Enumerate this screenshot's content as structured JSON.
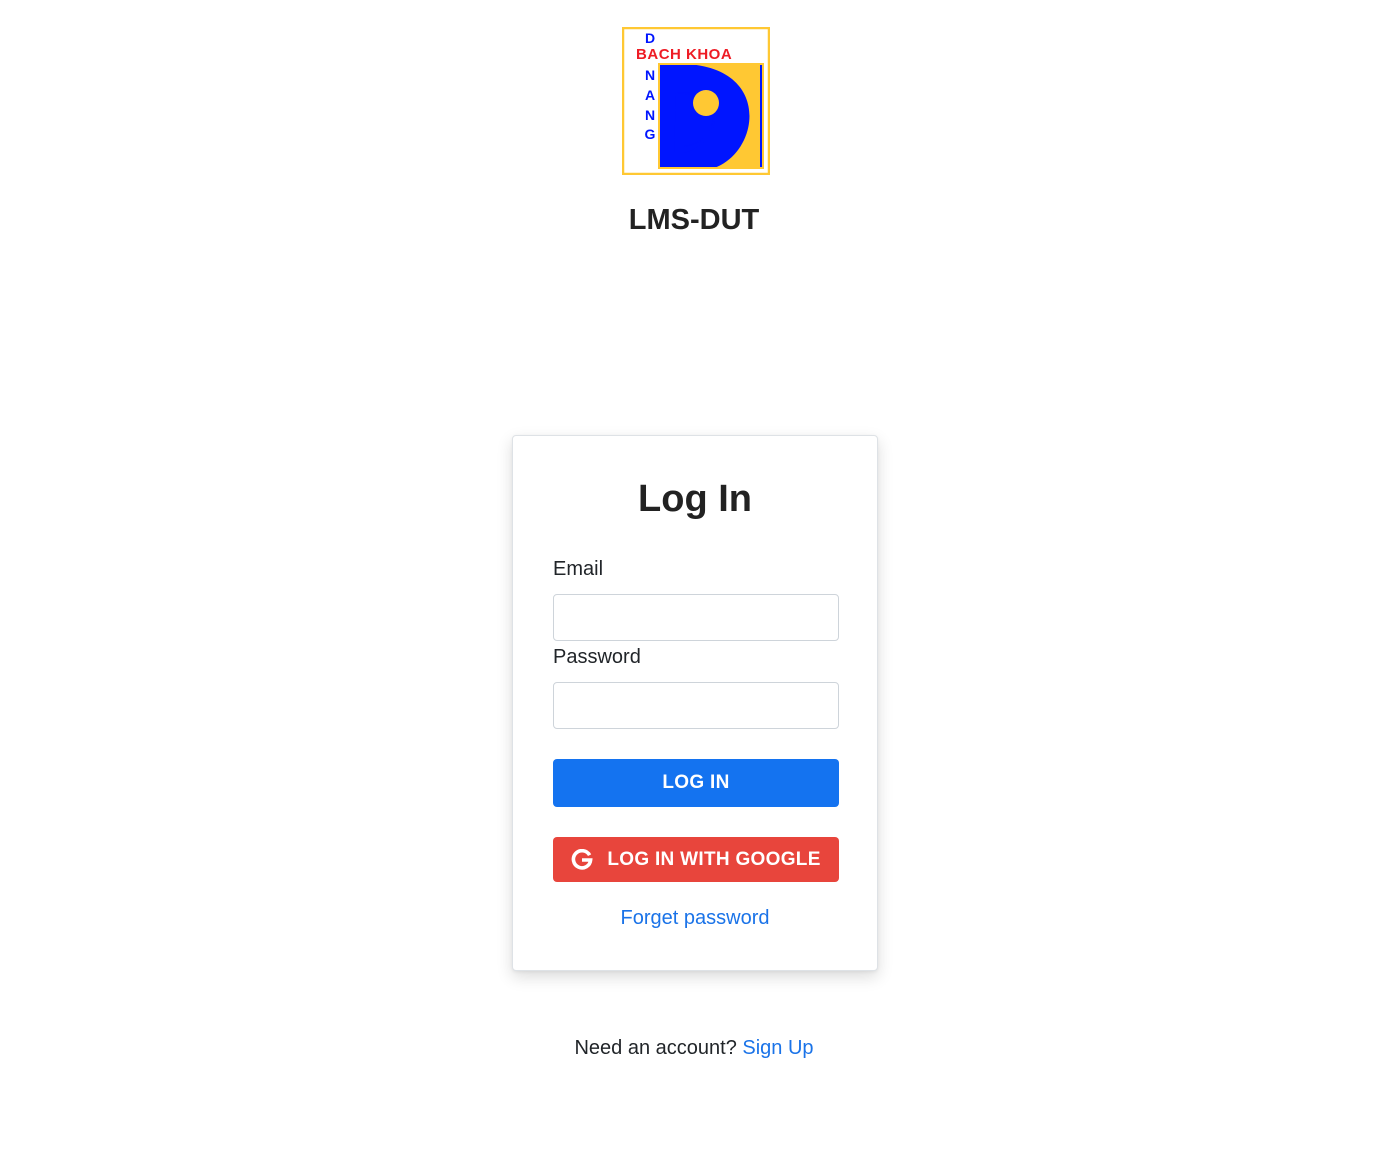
{
  "logo": {
    "top_text": "BACH KHOA",
    "side_text": "DANANG",
    "colors": {
      "border": "#ffc833",
      "blue": "#0015ff",
      "yellow": "#ffc833",
      "red": "#ee1c25"
    }
  },
  "app": {
    "title": "LMS-DUT"
  },
  "login_card": {
    "title": "Log In",
    "email_label": "Email",
    "email_value": "",
    "password_label": "Password",
    "password_value": "",
    "login_button": "LOG IN",
    "google_button": "LOG IN WITH GOOGLE",
    "google_icon": "google-g-icon",
    "forgot_link": "Forget password"
  },
  "footer": {
    "prompt": "Need an account?",
    "signup_link": "Sign Up"
  },
  "theme": {
    "primary": "#1473f0",
    "google_red": "#e8453c",
    "link": "#1a73e8"
  }
}
